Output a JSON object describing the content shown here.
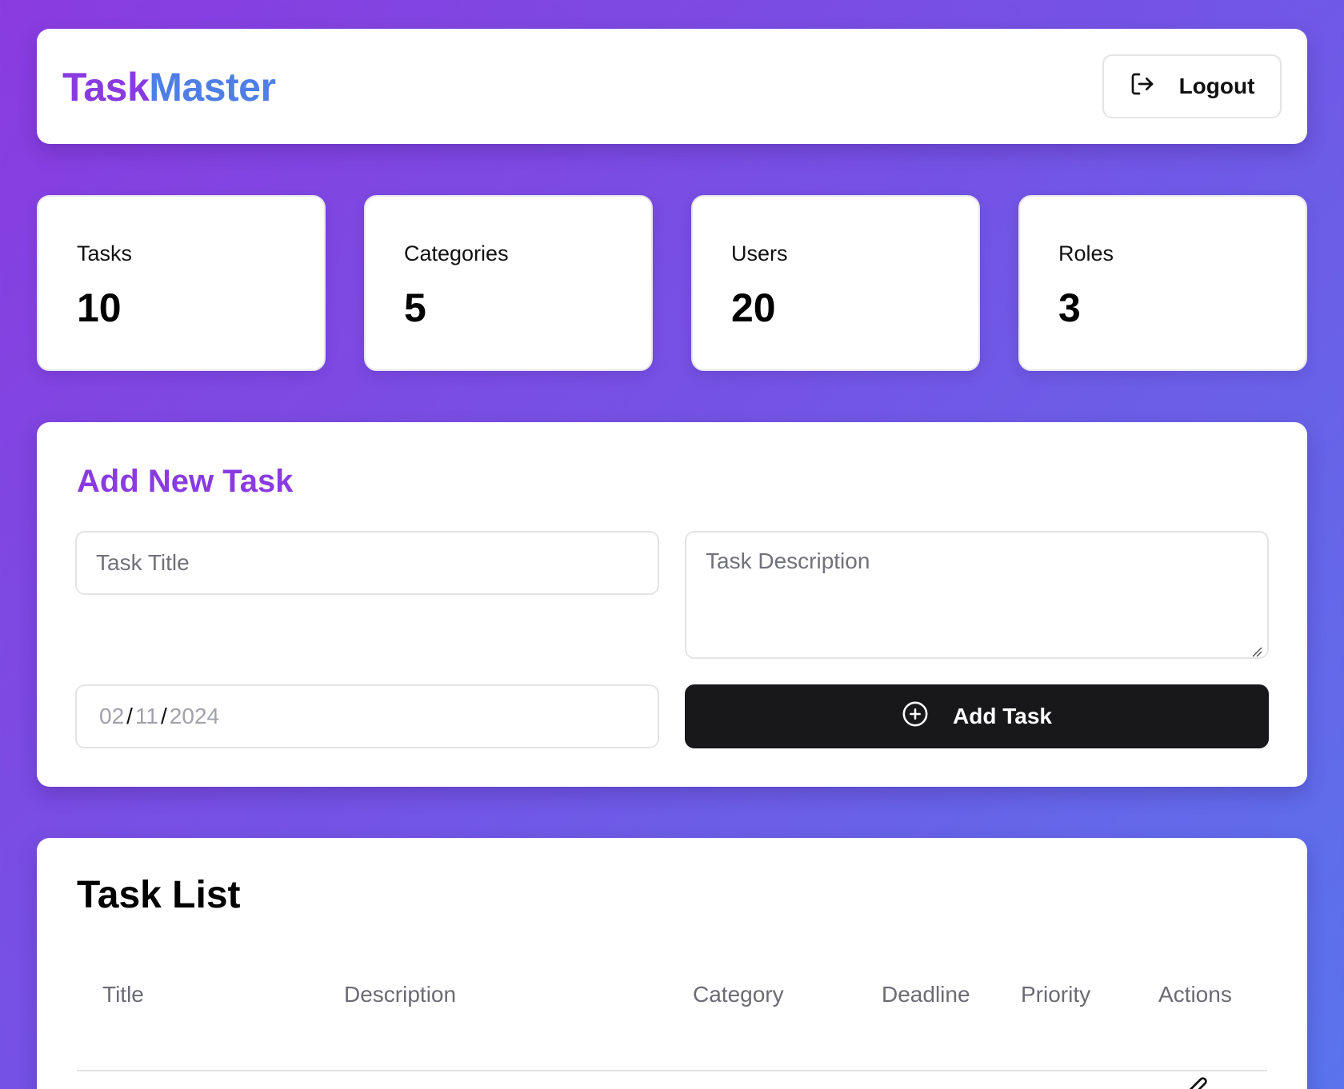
{
  "header": {
    "brand_part1": "Task",
    "brand_part2": "Master",
    "logout_label": "Logout",
    "logout_icon": "logout-icon"
  },
  "stats": [
    {
      "label": "Tasks",
      "value": "10"
    },
    {
      "label": "Categories",
      "value": "5"
    },
    {
      "label": "Users",
      "value": "20"
    },
    {
      "label": "Roles",
      "value": "3"
    }
  ],
  "add_task": {
    "heading": "Add New Task",
    "title_placeholder": "Task Title",
    "description_placeholder": "Task Description",
    "date": {
      "month": "02",
      "day": "11",
      "year": "2024",
      "separator": "/"
    },
    "button_label": "Add Task",
    "button_icon": "plus-circle-icon"
  },
  "task_list": {
    "heading": "Task List",
    "columns": [
      "Title",
      "Description",
      "Category",
      "Deadline",
      "Priority",
      "Actions"
    ],
    "row_action_icon": "edit-icon"
  },
  "colors": {
    "brand_purple": "#8a3be0",
    "brand_blue": "#4f7fe6",
    "button_dark": "#18181b",
    "background_gradient": [
      "#8a3be0",
      "#5a74ec"
    ]
  }
}
